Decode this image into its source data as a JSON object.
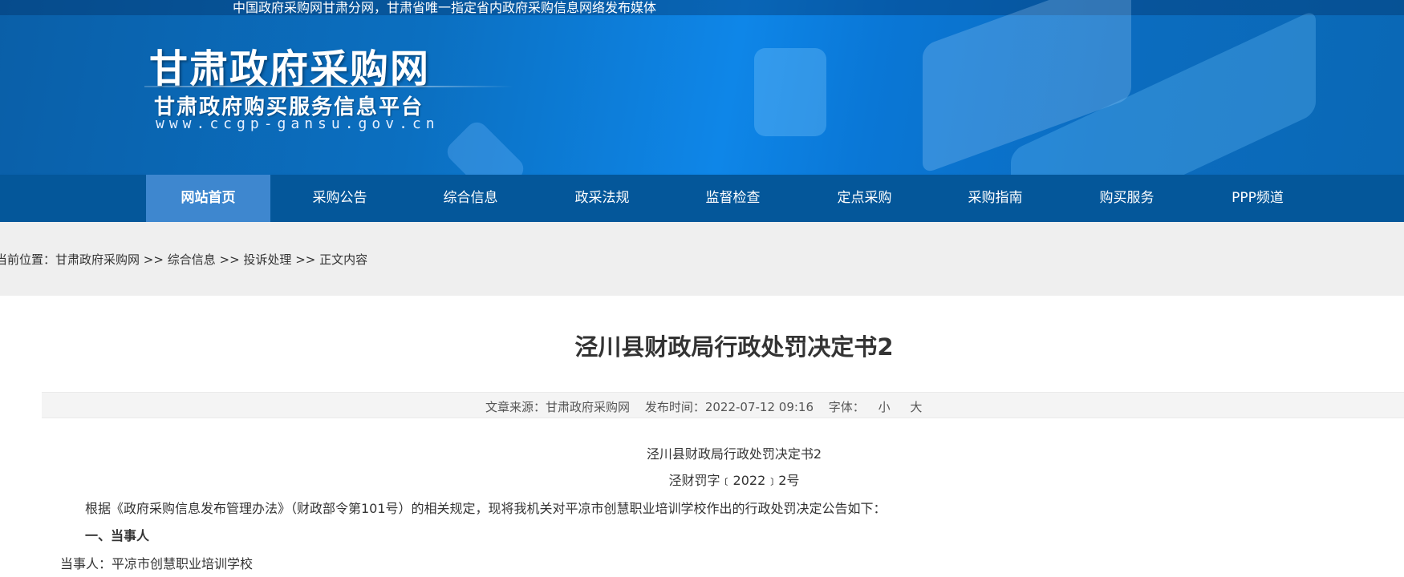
{
  "banner": {
    "top_text": "中国政府采购网甘肃分网，甘肃省唯一指定省内政府采购信息网络发布媒体",
    "logo_title": "甘肃政府采购网",
    "logo_subtitle": "甘肃政府购买服务信息平台",
    "logo_url": "www.ccgp-gansu.gov.cn"
  },
  "nav": {
    "items": [
      {
        "label": "网站首页",
        "active": true
      },
      {
        "label": "采购公告"
      },
      {
        "label": "综合信息"
      },
      {
        "label": "政采法规"
      },
      {
        "label": "监督检查"
      },
      {
        "label": "定点采购"
      },
      {
        "label": "采购指南"
      },
      {
        "label": "购买服务"
      },
      {
        "label": "PPP频道"
      }
    ]
  },
  "breadcrumb": {
    "prefix": "当前位置：",
    "items": [
      "甘肃政府采购网",
      "综合信息",
      "投诉处理",
      "正文内容"
    ],
    "separator": " >> "
  },
  "article": {
    "title": "泾川县财政局行政处罚决定书2",
    "meta": {
      "source_label": "文章来源：",
      "source": "甘肃政府采购网",
      "time_label": "发布时间：",
      "time": "2022-07-12 09:16",
      "font_label": "字体：",
      "font_small": "小",
      "font_large": "大"
    },
    "body_title": "泾川县财政局行政处罚决定书2",
    "doc_number": "泾财罚字﹝2022﹞2号",
    "intro": "根据《政府采购信息发布管理办法》（财政部令第101号）的相关规定，现将我机关对平凉市创慧职业培训学校作出的行政处罚决定公告如下：",
    "section1": "一、当事人",
    "party": "当事人：平凉市创慧职业培训学校"
  }
}
